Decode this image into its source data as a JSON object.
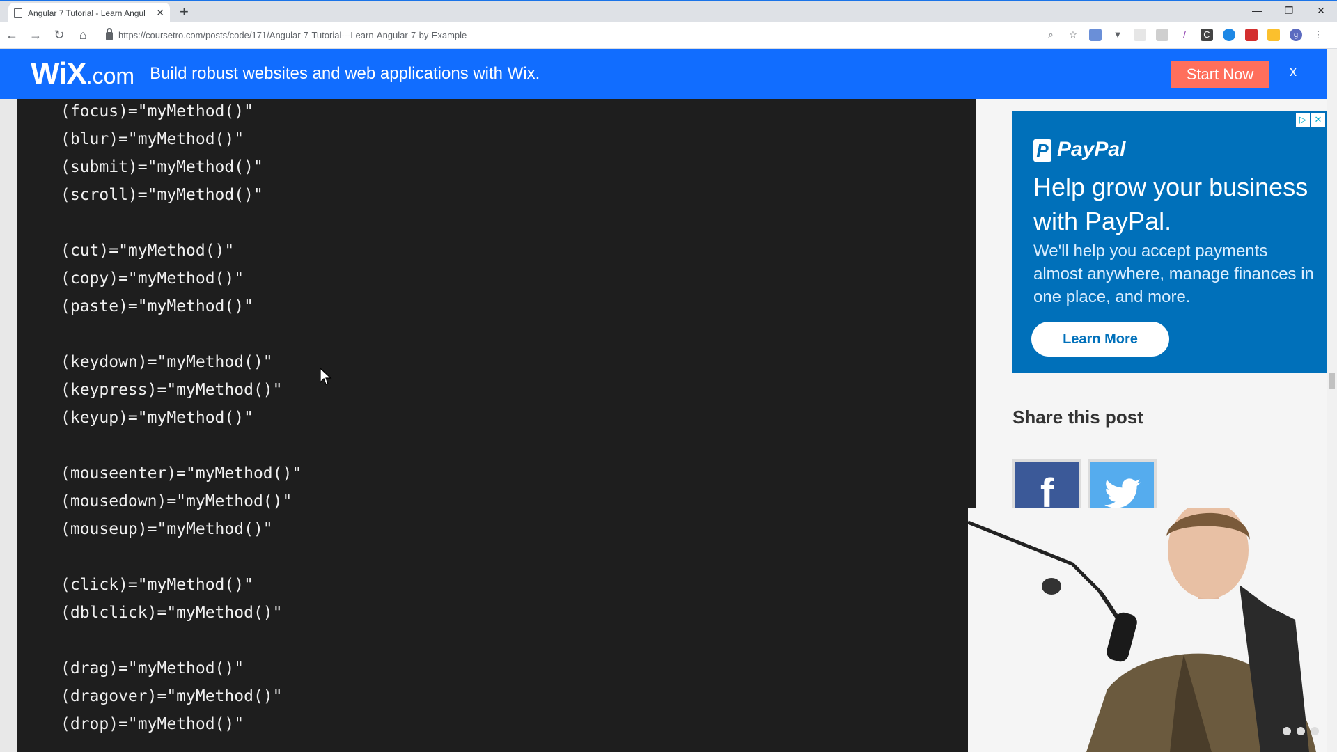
{
  "browser": {
    "tab_title": "Angular 7 Tutorial - Learn Angul",
    "url": "https://coursetro.com/posts/code/171/Angular-7-Tutorial---Learn-Angular-7-by-Example",
    "profile_initial": "g"
  },
  "banner": {
    "logo_main": "WiX",
    "logo_suffix": ".com",
    "text": "Build robust websites and web applications with Wix.",
    "cta": "Start Now",
    "close": "x",
    "color": "#116dff",
    "cta_color": "#ff6f5c"
  },
  "code_lines": [
    "(focus)=\"myMethod()\"",
    "(blur)=\"myMethod()\"",
    "(submit)=\"myMethod()\"",
    "(scroll)=\"myMethod()\"",
    "",
    "(cut)=\"myMethod()\"",
    "(copy)=\"myMethod()\"",
    "(paste)=\"myMethod()\"",
    "",
    "(keydown)=\"myMethod()\"",
    "(keypress)=\"myMethod()\"",
    "(keyup)=\"myMethod()\"",
    "",
    "(mouseenter)=\"myMethod()\"",
    "(mousedown)=\"myMethod()\"",
    "(mouseup)=\"myMethod()\"",
    "",
    "(click)=\"myMethod()\"",
    "(dblclick)=\"myMethod()\"",
    "",
    "(drag)=\"myMethod()\"",
    "(dragover)=\"myMethod()\"",
    "(drop)=\"myMethod()\""
  ],
  "ad": {
    "brand": "PayPal",
    "headline": "Help grow your business with PayPal.",
    "body": "We'll help you accept payments almost anywhere, manage finances in one place, and more.",
    "cta": "Learn More",
    "color": "#0070ba"
  },
  "share": {
    "title": "Share this post",
    "facebook_glyph": "f",
    "icons": [
      "facebook-icon",
      "twitter-icon"
    ]
  }
}
